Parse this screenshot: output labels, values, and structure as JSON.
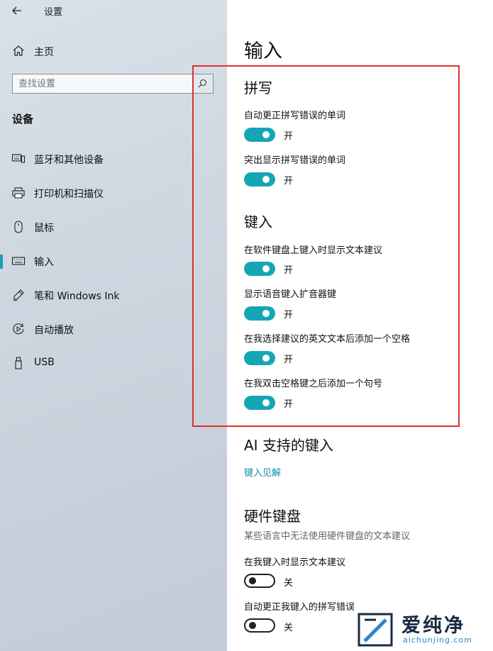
{
  "window": {
    "title": "设置"
  },
  "sidebar": {
    "home_label": "主页",
    "search": {
      "placeholder": "查找设置"
    },
    "section_heading": "设备",
    "items": [
      {
        "label": "蓝牙和其他设备",
        "icon": "bluetooth-devices-icon"
      },
      {
        "label": "打印机和扫描仪",
        "icon": "printer-icon"
      },
      {
        "label": "鼠标",
        "icon": "mouse-icon"
      },
      {
        "label": "输入",
        "icon": "keyboard-icon",
        "active": true
      },
      {
        "label": "笔和 Windows Ink",
        "icon": "pen-icon"
      },
      {
        "label": "自动播放",
        "icon": "autoplay-icon"
      },
      {
        "label": "USB",
        "icon": "usb-icon"
      }
    ]
  },
  "main": {
    "page_title": "输入",
    "spelling": {
      "title": "拼写",
      "settings": [
        {
          "label": "自动更正拼写错误的单词",
          "state": "开"
        },
        {
          "label": "突出显示拼写错误的单词",
          "state": "开"
        }
      ]
    },
    "typing": {
      "title": "键入",
      "settings": [
        {
          "label": "在软件键盘上键入时显示文本建议",
          "state": "开"
        },
        {
          "label": "显示语音键入扩音器键",
          "state": "开"
        },
        {
          "label": "在我选择建议的英文文本后添加一个空格",
          "state": "开"
        },
        {
          "label": "在我双击空格键之后添加一个句号",
          "state": "开"
        }
      ]
    },
    "ai": {
      "title": "AI 支持的键入",
      "link": "键入见解"
    },
    "hardware": {
      "title": "硬件键盘",
      "description": "某些语言中无法使用硬件键盘的文本建议",
      "settings": [
        {
          "label": "在我键入时显示文本建议",
          "state": "关"
        },
        {
          "label": "自动更正我键入的拼写错误",
          "state": "关"
        }
      ]
    }
  },
  "colors": {
    "accent": "#15a6b6",
    "highlight_border": "#dd3030",
    "link": "#0e8ea3"
  },
  "watermark": {
    "text": "爱纯净",
    "sub": "aichunjing.com"
  }
}
